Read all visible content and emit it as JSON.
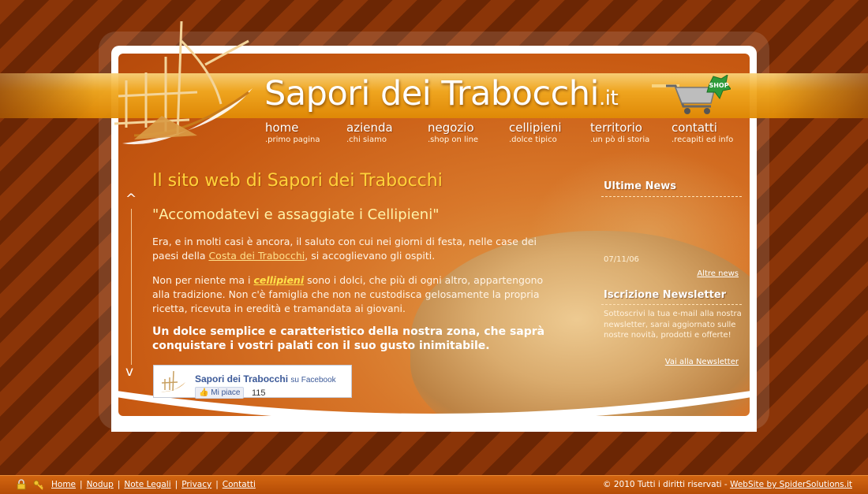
{
  "header": {
    "site_name": "Sapori dei Trabocchi",
    "site_tld": ".it",
    "cart_badge": "SHOP"
  },
  "nav": [
    {
      "label": "home",
      "sub": ".primo pagina"
    },
    {
      "label": "azienda",
      "sub": ".chi siamo"
    },
    {
      "label": "negozio",
      "sub": ".shop on line"
    },
    {
      "label": "cellipieni",
      "sub": ".dolce tipico"
    },
    {
      "label": "territorio",
      "sub": ".un pò di storia"
    },
    {
      "label": "contatti",
      "sub": ".recapiti ed info"
    }
  ],
  "main": {
    "title": "Il sito web di Sapori dei Trabocchi",
    "subtitle": "\"Accomodatevi e assaggiate i Cellipieni\"",
    "p1_before": "Era, e in molti casi è ancora, il saluto con cui nei giorni di festa, nelle case dei paesi della ",
    "p1_link": "Costa dei Trabocchi",
    "p1_after": ", si accoglievano gli ospiti.",
    "p2_before": "Non per niente ma i ",
    "p2_link": "cellipieni",
    "p2_after": " sono i dolci, che più di ogni altro, appartengono alla tradizione. Non c'è famiglia che non ne custodisca gelosamente la propria ricetta, ricevuta in eredità e tramandata ai giovani.",
    "highlight": "Un dolce semplice e caratteristico della nostra zona, che saprà conquistare i vostri palati con il suo gusto inimitabile.",
    "scroll_up": "^",
    "scroll_down": "v"
  },
  "facebook": {
    "page_name": "Sapori dei Trabocchi",
    "suffix": "su Facebook",
    "like_label": "Mi piace",
    "like_count": "115"
  },
  "sidebar": {
    "news_title": "Ultime News",
    "news_date": "07/11/06",
    "news_more": "Altre news",
    "newsletter_title": "Iscrizione Newsletter",
    "newsletter_text": "Sottoscrivi la tua e-mail alla nostra newsletter, sarai aggiornato sulle nostre novità, prodotti e offerte!",
    "newsletter_link": "Vai alla Newsletter"
  },
  "footer": {
    "links": [
      "Home",
      "Nodup",
      "Note Legali",
      "Privacy",
      "Contatti"
    ],
    "copyright": "© 2010 Tutti i diritti riservati - ",
    "credit": "WebSite by SpiderSolutions.it"
  },
  "colors": {
    "background_stripe_light": "#8b3508",
    "background_stripe_dark": "#6b2604",
    "banner": "#f1a920",
    "title_yellow": "#ffd23a"
  }
}
